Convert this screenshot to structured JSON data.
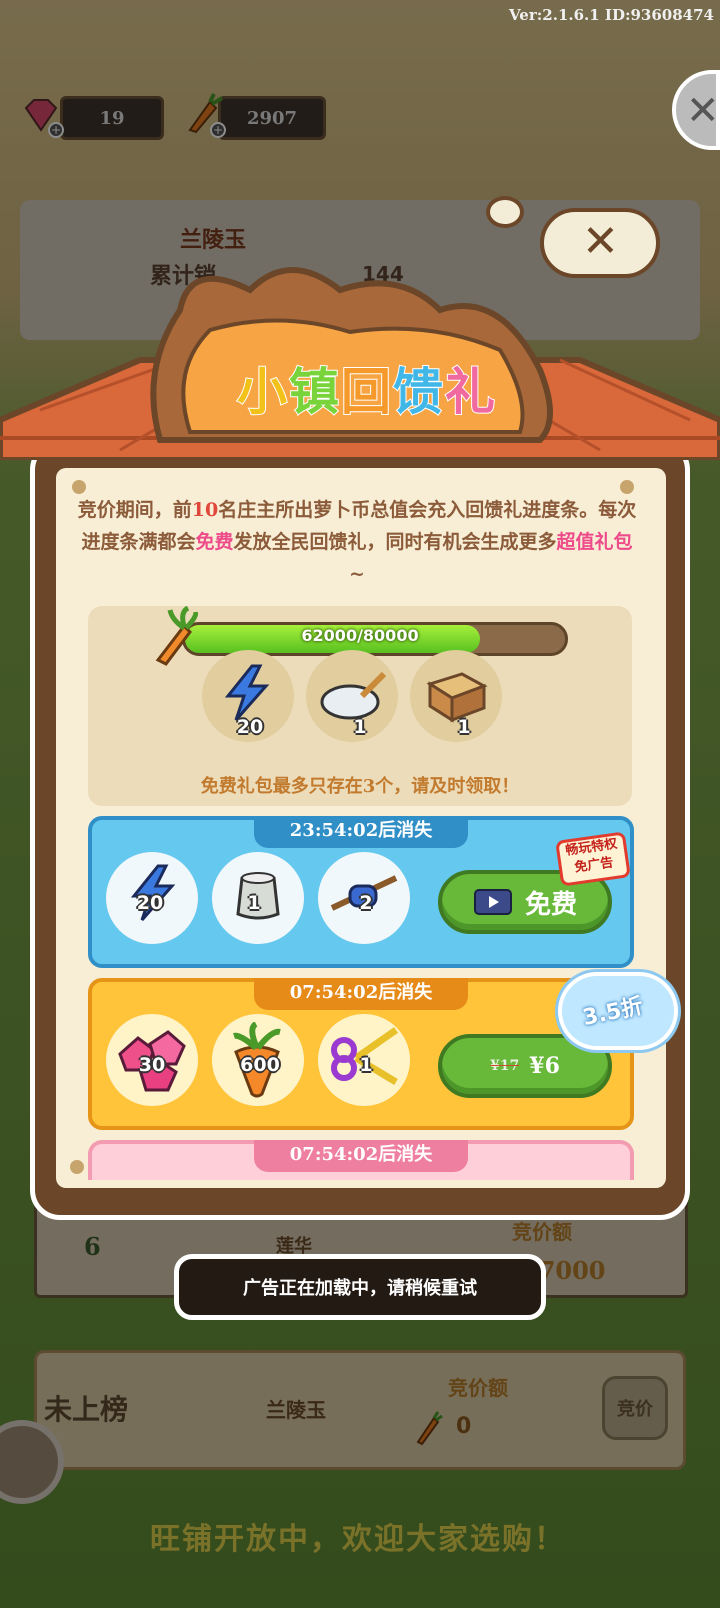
{
  "version": "Ver:2.1.6.1 ID:93608474",
  "resources": {
    "gems": "19",
    "carrots": "2907"
  },
  "background_card": {
    "name": "兰陵玉",
    "subtitle": "累计销",
    "value": "144"
  },
  "leaderboard_row": {
    "rank": "6",
    "name": "莲华",
    "bid_label": "竞价额",
    "bid_value": "27000"
  },
  "my_row": {
    "status": "未上榜",
    "name": "兰陵玉",
    "bid_label": "竞价额",
    "bid_value": "0",
    "bid_button": "竞价"
  },
  "marquee": "旺铺开放中，欢迎大家选购！",
  "popup": {
    "title_chars": [
      "小",
      "镇",
      "回",
      "馈",
      "礼"
    ],
    "title_colors": [
      "#f2c21b",
      "#79d33a",
      "#f59a2a",
      "#41b7e8",
      "#f06aa0"
    ],
    "description_parts": {
      "a": "竞价期间，前",
      "num": "10",
      "b": "名庄主所出萝卜币总值会充入回馈礼进度条。每次进度条满都会",
      "free": "免费",
      "c": "发放全民回馈礼，同时有机会生成更多",
      "value_pack": "超值礼包",
      "d": "~"
    },
    "progress": {
      "current": 62000,
      "max": 80000,
      "text": "62000/80000"
    },
    "progress_rewards": [
      {
        "icon": "lightning-icon",
        "qty": "20"
      },
      {
        "icon": "paint-bowl-icon",
        "qty": "1"
      },
      {
        "icon": "wooden-crate-icon",
        "qty": "1"
      }
    ],
    "free_note": "免费礼包最多只存在3个，请及时领取！",
    "packs": [
      {
        "timer": "23:54:02后消失",
        "items": [
          {
            "icon": "lightning-icon",
            "qty": "20"
          },
          {
            "icon": "sack-icon",
            "qty": "1"
          },
          {
            "icon": "tools-icon",
            "qty": "2"
          }
        ],
        "button": "免费",
        "badge_line1": "畅玩特权",
        "badge_line2": "免广告"
      },
      {
        "timer": "07:54:02后消失",
        "items": [
          {
            "icon": "pink-gems-icon",
            "qty": "30"
          },
          {
            "icon": "carrot-icon",
            "qty": "600"
          },
          {
            "icon": "scissors-icon",
            "qty": "1"
          }
        ],
        "old_price": "¥17",
        "price": "¥6",
        "discount": "3.5折"
      },
      {
        "timer": "07:54:02后消失"
      }
    ]
  },
  "toast": "广告正在加载中，请稍候重试",
  "colors": {
    "accent_green": "#68b83a",
    "wood": "#6b4628",
    "blue_pack": "#64c8ef",
    "orange_pack": "#ffc43a",
    "pink_pack": "#ffcfd9"
  }
}
